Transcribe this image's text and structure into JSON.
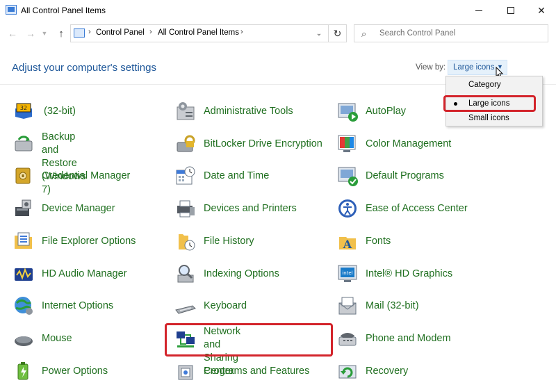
{
  "window": {
    "title": "All Control Panel Items"
  },
  "address_bar": {
    "breadcrumbs": [
      "Control Panel",
      "All Control Panel Items"
    ]
  },
  "search": {
    "placeholder": "Search Control Panel"
  },
  "header": {
    "heading": "Adjust your computer's settings",
    "view_by_label": "View by:",
    "view_by_value": "Large icons"
  },
  "view_menu": {
    "options": [
      {
        "label": "Category",
        "selected": false
      },
      {
        "label": "Large icons",
        "selected": true
      },
      {
        "label": "Small icons",
        "selected": false
      }
    ]
  },
  "items": [
    {
      "label": "(32-bit)",
      "icon": "java-icon"
    },
    {
      "label": "Administrative Tools",
      "icon": "administrative-tools-icon"
    },
    {
      "label": "AutoPlay",
      "icon": "autoplay-icon"
    },
    {
      "label": "Backup and Restore\n(Windows 7)",
      "icon": "backup-restore-icon"
    },
    {
      "label": "BitLocker Drive Encryption",
      "icon": "bitlocker-icon"
    },
    {
      "label": "Color Management",
      "icon": "color-management-icon"
    },
    {
      "label": "Credential Manager",
      "icon": "credential-manager-icon"
    },
    {
      "label": "Date and Time",
      "icon": "date-time-icon"
    },
    {
      "label": "Default Programs",
      "icon": "default-programs-icon"
    },
    {
      "label": "Device Manager",
      "icon": "device-manager-icon"
    },
    {
      "label": "Devices and Printers",
      "icon": "devices-printers-icon"
    },
    {
      "label": "Ease of Access Center",
      "icon": "ease-of-access-icon"
    },
    {
      "label": "File Explorer Options",
      "icon": "file-explorer-options-icon"
    },
    {
      "label": "File History",
      "icon": "file-history-icon"
    },
    {
      "label": "Fonts",
      "icon": "fonts-icon"
    },
    {
      "label": "HD Audio Manager",
      "icon": "hd-audio-icon"
    },
    {
      "label": "Indexing Options",
      "icon": "indexing-options-icon"
    },
    {
      "label": "Intel® HD Graphics",
      "icon": "intel-graphics-icon"
    },
    {
      "label": "Internet Options",
      "icon": "internet-options-icon"
    },
    {
      "label": "Keyboard",
      "icon": "keyboard-icon"
    },
    {
      "label": "Mail (32-bit)",
      "icon": "mail-icon"
    },
    {
      "label": "Mouse",
      "icon": "mouse-icon"
    },
    {
      "label": "Network and Sharing\nCenter",
      "icon": "network-sharing-icon"
    },
    {
      "label": "Phone and Modem",
      "icon": "phone-modem-icon"
    },
    {
      "label": "Power Options",
      "icon": "power-options-icon"
    },
    {
      "label": "Programs and Features",
      "icon": "programs-features-icon"
    },
    {
      "label": "Recovery",
      "icon": "recovery-icon"
    }
  ]
}
